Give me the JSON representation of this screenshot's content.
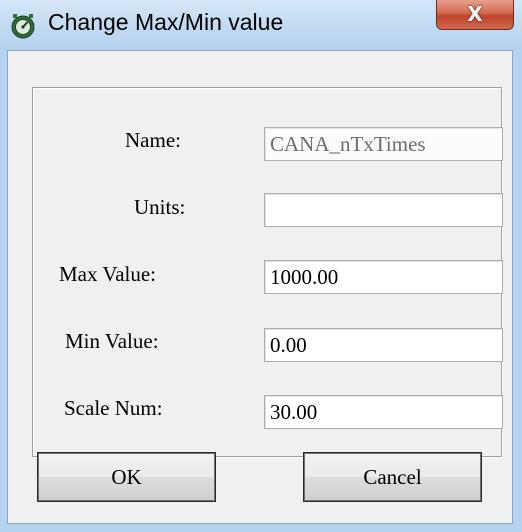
{
  "window": {
    "title": "Change Max/Min value",
    "close_label": "X",
    "app_icon": "gauge-icon"
  },
  "form": {
    "name": {
      "label": "Name:",
      "value": "CANA_nTxTimes",
      "disabled": true
    },
    "units": {
      "label": "Units:",
      "value": ""
    },
    "max": {
      "label": "Max Value:",
      "value": "1000.00"
    },
    "min": {
      "label": "Min Value:",
      "value": "0.00"
    },
    "scale": {
      "label": "Scale Num:",
      "value": "30.00"
    }
  },
  "buttons": {
    "ok": "OK",
    "cancel": "Cancel"
  }
}
